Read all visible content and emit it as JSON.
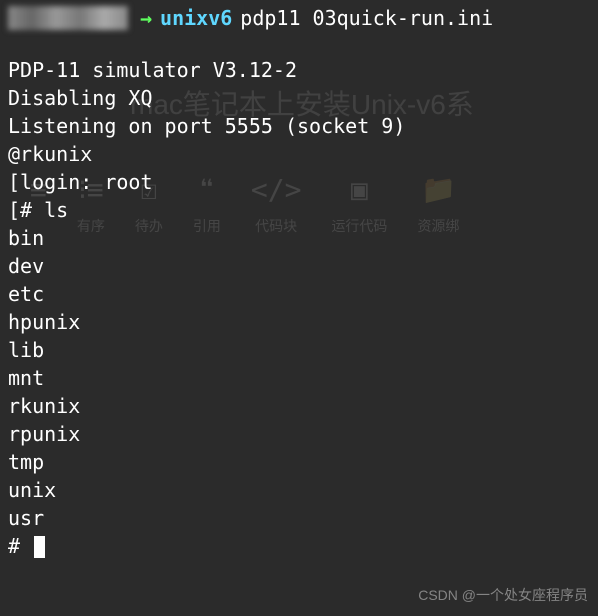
{
  "prompt": {
    "arrow": "→",
    "dir": "unixv6",
    "command": "pdp11 03quick-run.ini"
  },
  "output": {
    "line1": "PDP-11 simulator V3.12-2",
    "line2": "Disabling XQ",
    "line3": "Listening on port 5555 (socket 9)",
    "line4": "@rkunix",
    "blank1": "",
    "line5_bracket": "[",
    "line5": "login: root",
    "line6_bracket": "[",
    "line6": "# ls",
    "ls_items": [
      "bin",
      "dev",
      "etc",
      "hpunix",
      "lib",
      "mnt",
      "rkunix",
      "rpunix",
      "tmp",
      "unix",
      "usr"
    ],
    "final_prompt": "# "
  },
  "bg_title": "mac笔记本上安装Unix-v6系",
  "bg_toolbar": {
    "item2": "有序",
    "item3": "待办",
    "item4": "引用",
    "item5": "代码块",
    "item6": "运行代码",
    "item7": "资源绑"
  },
  "watermark": "CSDN @一个处女座程序员"
}
